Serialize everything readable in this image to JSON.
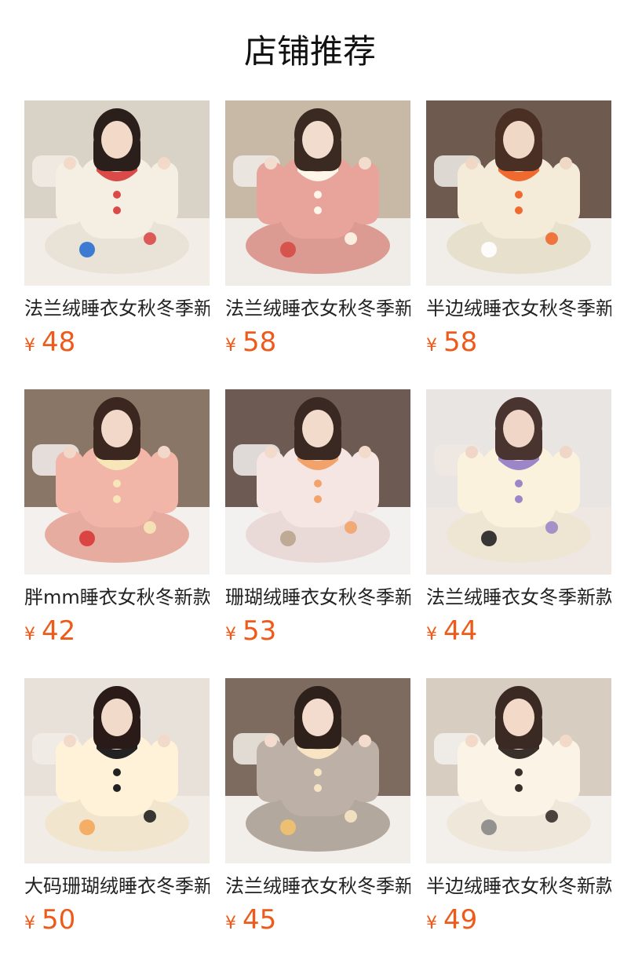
{
  "page": {
    "title": "店铺推荐"
  },
  "products": [
    {
      "name": "法兰绒睡衣女秋冬季新款",
      "currency": "¥",
      "price": "48",
      "image": {
        "bg": "#d9d2c7",
        "floor": "#f2ede6",
        "outfit": "#f5efe3",
        "accent": "#d94a48",
        "hair": "#2b1f1c",
        "skin": "#f2d9c8",
        "extra": "#2a6fd0"
      }
    },
    {
      "name": "法兰绒睡衣女秋冬季新款",
      "currency": "¥",
      "price": "58",
      "image": {
        "bg": "#c7b9a5",
        "floor": "#f0ece8",
        "outfit": "#e8a49a",
        "accent": "#fff6ea",
        "hair": "#3a2a22",
        "skin": "#f2dccd",
        "extra": "#d64b46"
      }
    },
    {
      "name": "半边绒睡衣女秋冬季新款",
      "currency": "¥",
      "price": "58",
      "image": {
        "bg": "#6f5a4f",
        "floor": "#f1eee9",
        "outfit": "#f4ecd8",
        "accent": "#f0692f",
        "hair": "#4a3024",
        "skin": "#f0d8c6",
        "extra": "#ffffff"
      }
    },
    {
      "name": "胖mm睡衣女秋冬新款",
      "currency": "¥",
      "price": "42",
      "image": {
        "bg": "#8a7666",
        "floor": "#f3f0ee",
        "outfit": "#f2b6a8",
        "accent": "#f7e7b8",
        "hair": "#3b2620",
        "skin": "#f1d8c8",
        "extra": "#d83a3a"
      }
    },
    {
      "name": "珊瑚绒睡衣女秋冬季新款",
      "currency": "¥",
      "price": "53",
      "image": {
        "bg": "#6d5a52",
        "floor": "#f3f1ef",
        "outfit": "#f6e6e3",
        "accent": "#f2a36b",
        "hair": "#3a2822",
        "skin": "#f3dbcc",
        "extra": "#b9a48e"
      }
    },
    {
      "name": "法兰绒睡衣女冬季新款",
      "currency": "¥",
      "price": "44",
      "image": {
        "bg": "#e9e5e2",
        "floor": "#efe8e2",
        "outfit": "#fbf2de",
        "accent": "#9d86c7",
        "hair": "#4a3430",
        "skin": "#f0d6c7",
        "extra": "#222222"
      }
    },
    {
      "name": "大码珊瑚绒睡衣冬季新款",
      "currency": "¥",
      "price": "50",
      "image": {
        "bg": "#e7e1d9",
        "floor": "#f1ece6",
        "outfit": "#fff2d8",
        "accent": "#222222",
        "hair": "#2a1b18",
        "skin": "#f2dacb",
        "extra": "#f4a75a"
      }
    },
    {
      "name": "法兰绒睡衣女秋冬季新款",
      "currency": "¥",
      "price": "45",
      "image": {
        "bg": "#7e6b60",
        "floor": "#f2eee9",
        "outfit": "#bdb1a7",
        "accent": "#f7e4c2",
        "hair": "#2e211c",
        "skin": "#f3dccd",
        "extra": "#f3c16d"
      }
    },
    {
      "name": "半边绒睡衣女秋冬新款",
      "currency": "¥",
      "price": "49",
      "image": {
        "bg": "#d7cdc0",
        "floor": "#f3f0ec",
        "outfit": "#fbf4e6",
        "accent": "#3a302b",
        "hair": "#3b2923",
        "skin": "#f2d9c8",
        "extra": "#888888"
      }
    }
  ]
}
